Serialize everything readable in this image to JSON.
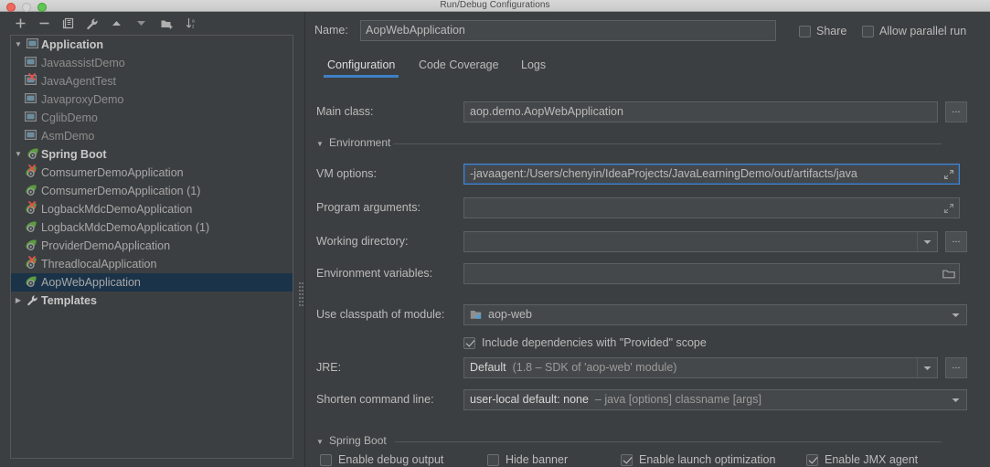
{
  "window": {
    "title": "Run/Debug Configurations",
    "traffic_lights": [
      "close-button",
      "minimize-button",
      "zoom-button"
    ]
  },
  "toolbar": {
    "buttons": [
      {
        "name": "add-configuration-button",
        "icon": "plus-icon",
        "tooltip": "Add New Configuration"
      },
      {
        "name": "remove-configuration-button",
        "icon": "minus-icon",
        "tooltip": "Remove Configuration"
      },
      {
        "name": "copy-configuration-button",
        "icon": "copy-icon",
        "tooltip": "Copy Configuration"
      },
      {
        "name": "edit-defaults-button",
        "icon": "wrench-icon",
        "tooltip": "Edit defaults"
      },
      {
        "name": "move-up-button",
        "icon": "arrow-up-icon",
        "tooltip": "Move Up"
      },
      {
        "name": "move-down-button",
        "icon": "arrow-down-icon",
        "tooltip": "Move Down"
      },
      {
        "name": "new-folder-button",
        "icon": "folder-add-icon",
        "tooltip": "Create New Folder"
      },
      {
        "name": "sort-button",
        "icon": "sort-alpha-icon",
        "tooltip": "Sort Configurations"
      }
    ]
  },
  "tree": {
    "groups": [
      {
        "label": "Application",
        "icon": "application-icon",
        "expanded": true,
        "twisty": "▼",
        "children": [
          {
            "label": "JavaassistDemo",
            "icon": "application-icon",
            "error": false,
            "dim": true
          },
          {
            "label": "JavaAgentTest",
            "icon": "application-icon",
            "error": true,
            "dim": true
          },
          {
            "label": "JavaproxyDemo",
            "icon": "application-icon",
            "error": false,
            "dim": true
          },
          {
            "label": "CglibDemo",
            "icon": "application-icon",
            "error": false,
            "dim": true
          },
          {
            "label": "AsmDemo",
            "icon": "application-icon",
            "error": false,
            "dim": true
          }
        ]
      },
      {
        "label": "Spring Boot",
        "icon": "spring-boot-icon",
        "expanded": true,
        "twisty": "▼",
        "children": [
          {
            "label": "ComsumerDemoApplication",
            "icon": "spring-boot-icon",
            "error": true,
            "selected": false
          },
          {
            "label": "ComsumerDemoApplication (1)",
            "icon": "spring-boot-icon",
            "error": false,
            "selected": false
          },
          {
            "label": "LogbackMdcDemoApplication",
            "icon": "spring-boot-icon",
            "error": true,
            "selected": false
          },
          {
            "label": "LogbackMdcDemoApplication (1)",
            "icon": "spring-boot-icon",
            "error": false,
            "selected": false
          },
          {
            "label": "ProviderDemoApplication",
            "icon": "spring-boot-icon",
            "error": false,
            "selected": false
          },
          {
            "label": "ThreadlocalApplication",
            "icon": "spring-boot-icon",
            "error": true,
            "selected": false
          },
          {
            "label": "AopWebApplication",
            "icon": "spring-boot-icon",
            "error": false,
            "selected": true
          }
        ]
      },
      {
        "label": "Templates",
        "icon": "wrench-icon",
        "expanded": false,
        "twisty": "▶",
        "children": []
      }
    ]
  },
  "header": {
    "name_label": "Name:",
    "name_value": "AopWebApplication",
    "share_label": "Share",
    "share_checked": false,
    "parallel_label": "Allow parallel run",
    "parallel_checked": false
  },
  "tabs": [
    {
      "label": "Configuration",
      "active": true
    },
    {
      "label": "Code Coverage",
      "active": false
    },
    {
      "label": "Logs",
      "active": false
    }
  ],
  "form": {
    "main_class": {
      "label": "Main class:",
      "value": "aop.demo.AopWebApplication",
      "browse": "..."
    },
    "environment_section": {
      "label": "Environment",
      "arrow": "▼",
      "expanded": true
    },
    "vm_options": {
      "label": "VM options:",
      "value": "-javaagent:/Users/chenyin/IdeaProjects/JavaLearningDemo/out/artifacts/java",
      "focused": true
    },
    "program_arguments": {
      "label": "Program arguments:",
      "value": ""
    },
    "working_directory": {
      "label": "Working directory:",
      "value": "",
      "browse": "..."
    },
    "environment_variables": {
      "label": "Environment variables:",
      "value": ""
    },
    "use_classpath_of_module": {
      "label": "Use classpath of module:",
      "value": "aop-web",
      "icon": "module-icon"
    },
    "include_provided": {
      "label": "Include dependencies with \"Provided\" scope",
      "checked": true
    },
    "jre": {
      "label": "JRE:",
      "value_bold": "Default",
      "value_rest": "(1.8 – SDK of 'aop-web' module)",
      "browse": "..."
    },
    "shorten_command_line": {
      "label": "Shorten command line:",
      "value_bold": "user-local default: none",
      "value_rest": "– java [options] classname [args]"
    },
    "spring_boot_section": {
      "label": "Spring Boot",
      "arrow": "▼",
      "expanded": true
    },
    "spring_boot_options": [
      {
        "label": "Enable debug output",
        "checked": false,
        "name": "enable-debug-output-checkbox"
      },
      {
        "label": "Hide banner",
        "checked": false,
        "name": "hide-banner-checkbox"
      },
      {
        "label": "Enable launch optimization",
        "checked": true,
        "name": "enable-launch-optimization-checkbox"
      },
      {
        "label": "Enable JMX agent",
        "checked": true,
        "name": "enable-jmx-agent-checkbox"
      }
    ]
  },
  "colors": {
    "panel_bg": "#3c3f41",
    "field_bg": "#45484a",
    "border": "#5e6163",
    "text": "#bbbbbb",
    "selection_bg": "#1b3349",
    "accent_blue": "#3f80c6",
    "focus_blue": "#4b83c6",
    "spring_green": "#5d9b40",
    "error_red": "#d9534f"
  }
}
